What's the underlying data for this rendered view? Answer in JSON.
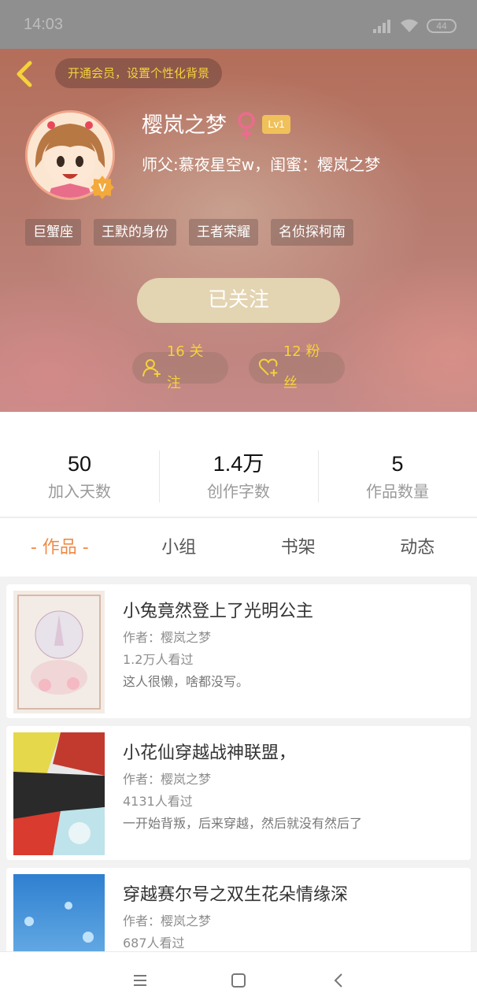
{
  "status_bar": {
    "time": "14:03",
    "battery": "44",
    "icons": [
      "signal-icon",
      "wifi-icon",
      "battery-icon"
    ]
  },
  "header": {
    "vip_banner": "开通会员，设置个性化背景",
    "username": "樱岚之梦",
    "level": "Lv1",
    "relations": "师父:慕夜星空w，闺蜜：樱岚之梦",
    "tags": [
      "巨蟹座",
      "王默的身份",
      "王者荣耀",
      "名侦探柯南"
    ],
    "follow_button": "已关注",
    "following": "16 关注",
    "fans": "12 粉丝",
    "accent_color": "#f5d23a"
  },
  "stats": [
    {
      "value": "50",
      "label": "加入天数"
    },
    {
      "value": "1.4万",
      "label": "创作字数"
    },
    {
      "value": "5",
      "label": "作品数量"
    }
  ],
  "tabs": [
    {
      "label": "- 作品 -",
      "active": true
    },
    {
      "label": "小组",
      "active": false
    },
    {
      "label": "书架",
      "active": false
    },
    {
      "label": "动态",
      "active": false
    }
  ],
  "works": [
    {
      "title": "小兔竟然登上了光明公主",
      "author": "作者：樱岚之梦",
      "views": "1.2万人看过",
      "desc": "这人很懒，啥都没写。"
    },
    {
      "title": "小花仙穿越战神联盟，",
      "author": "作者：樱岚之梦",
      "views": "4131人看过",
      "desc": "一开始背叛，后来穿越，然后就没有然后了"
    },
    {
      "title": "穿越赛尔号之双生花朵情缘深",
      "author": "作者：樱岚之梦",
      "views": "687人看过",
      "desc": ""
    }
  ],
  "nav": [
    "menu-icon",
    "home-icon",
    "back-icon"
  ]
}
